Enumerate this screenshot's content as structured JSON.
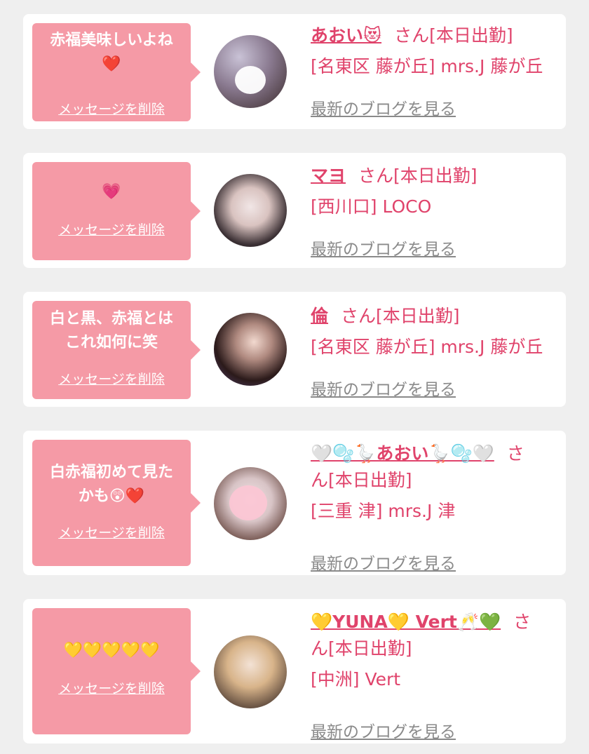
{
  "messages": [
    {
      "message": "赤福美味しいよね\n❤️",
      "delete_label": "メッセージを削除",
      "cast_name": "あおい😻",
      "honorific": "さん",
      "status": "[本日出勤]",
      "area_shop": "[名東区 藤が丘] mrs.J 藤が丘",
      "blog_label": "最新のブログを見る",
      "avatar_colors": [
        "#c9c2d6",
        "#3a2a2a",
        "#e8d4c8"
      ]
    },
    {
      "message": "💗",
      "delete_label": "メッセージを削除",
      "cast_name": "マヨ",
      "honorific": "さん",
      "status": "[本日出勤]",
      "area_shop": "[西川口] LOCO",
      "blog_label": "最新のブログを見る",
      "avatar_colors": [
        "#1e1a1c",
        "#d9c3c0",
        "#f1e6e6"
      ]
    },
    {
      "message": "白と黒、赤福とは\nこれ如何に笑",
      "delete_label": "メッセージを削除",
      "cast_name": "倫",
      "honorific": "さん",
      "status": "[本日出勤]",
      "area_shop": "[名東区 藤が丘] mrs.J 藤が丘",
      "blog_label": "最新のブログを見る",
      "avatar_colors": [
        "#5a4a7a",
        "#2b1a1a",
        "#f2d9cf"
      ]
    },
    {
      "message": "白赤福初めて見た\nかも😲❤️",
      "delete_label": "メッセージを削除",
      "cast_name": "🤍🫧🪿あおい🪿🫧🤍",
      "honorific": "さ",
      "honorific_cont": "ん",
      "status": "[本日出勤]",
      "area_shop": "[三重 津] mrs.J 津",
      "blog_label": "最新のブログを見る",
      "avatar_colors": [
        "#e6d8dc",
        "#6b4b44",
        "#fbc6d4"
      ]
    },
    {
      "message": "💛💛💛💛💛",
      "delete_label": "メッセージを削除",
      "cast_name": "💛YUNA💛 Vert🥂💚",
      "honorific": "さ",
      "honorific_cont": "ん",
      "status": "[本日出勤]",
      "area_shop": "[中洲] Vert",
      "blog_label": "最新のブログを見る",
      "avatar_colors": [
        "#4a3a32",
        "#d8b48a",
        "#f3e2d5"
      ]
    }
  ]
}
